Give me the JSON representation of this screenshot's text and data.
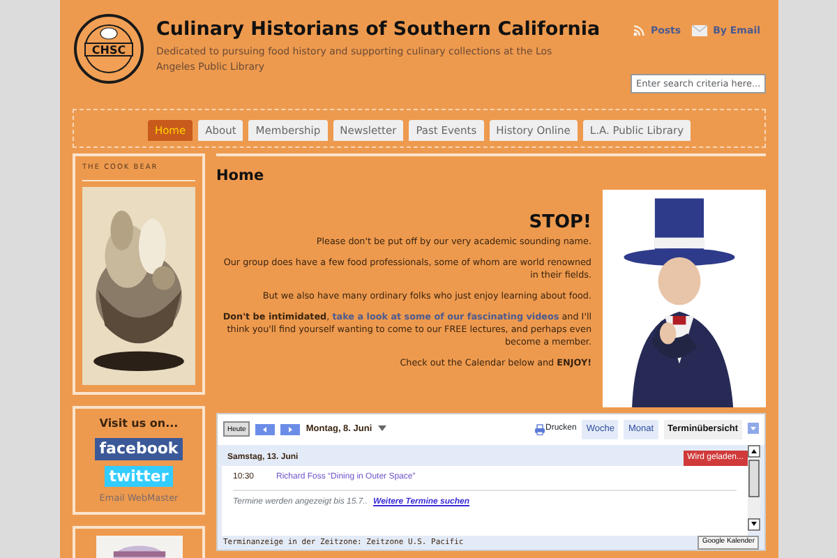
{
  "header": {
    "logo_text": "CHSC",
    "title": "Culinary Historians of Southern California",
    "tagline": "Dedicated to pursuing food history and supporting culinary collections at the Los Angeles Public Library",
    "links": [
      {
        "label": "Posts",
        "kind": "rss"
      },
      {
        "label": "By Email",
        "kind": "email"
      }
    ],
    "search": {
      "placeholder": "Enter search criteria here..."
    }
  },
  "nav": [
    {
      "label": "Home",
      "selected": true
    },
    {
      "label": "About",
      "selected": false
    },
    {
      "label": "Membership",
      "selected": false
    },
    {
      "label": "Newsletter",
      "selected": false
    },
    {
      "label": "Past Events",
      "selected": false
    },
    {
      "label": "History Online",
      "selected": false
    },
    {
      "label": "L.A. Public Library",
      "selected": false
    }
  ],
  "sidebar": {
    "cook_bear_title": "THE COOK BEAR",
    "social_title": "Visit us on...",
    "facebook": "facebook",
    "twitter": "twitter",
    "email": "Email WebMaster"
  },
  "main": {
    "heading": "Home",
    "stop": "STOP!",
    "paragraphs": [
      {
        "kind": "plain",
        "text": "Please don't be put off by our very academic sounding name."
      },
      {
        "kind": "plain",
        "text": "Our group does have a few food professionals, some of whom are world renowned in their fields."
      },
      {
        "kind": "plain",
        "text": "But we also have many ordinary folks who just enjoy learning about food."
      },
      {
        "kind": "link",
        "lead": "**Don't be intimidated**,",
        "link": "take a look at some of our fascinating videos",
        "text": "and I'll think you'll find yourself wanting to come to our FREE lectures, and perhaps even become a member."
      },
      {
        "kind": "plain",
        "text": "Check out the Calendar below and **ENJOY!**"
      }
    ]
  },
  "calendar": {
    "today": "Heute",
    "date": "Montag, 8. Juni",
    "print": "Drucken",
    "views": [
      {
        "label": "Woche",
        "selected": false
      },
      {
        "label": "Monat",
        "selected": false
      },
      {
        "label": "Terminübersicht",
        "selected": true
      }
    ],
    "day": "Samstag, 13. Juni",
    "loading": "Wird geladen...",
    "events": [
      {
        "time": "10:30",
        "title": "Richard Foss “Dining in Outer Space”"
      }
    ],
    "note": "Termine werden angezeigt bis 15.7..",
    "more": "Weitere Termine suchen",
    "timezone": "Terminanzeige in der Zeitzone: Zeitzone U.S. Pacific",
    "badge": "Google Kalender"
  }
}
